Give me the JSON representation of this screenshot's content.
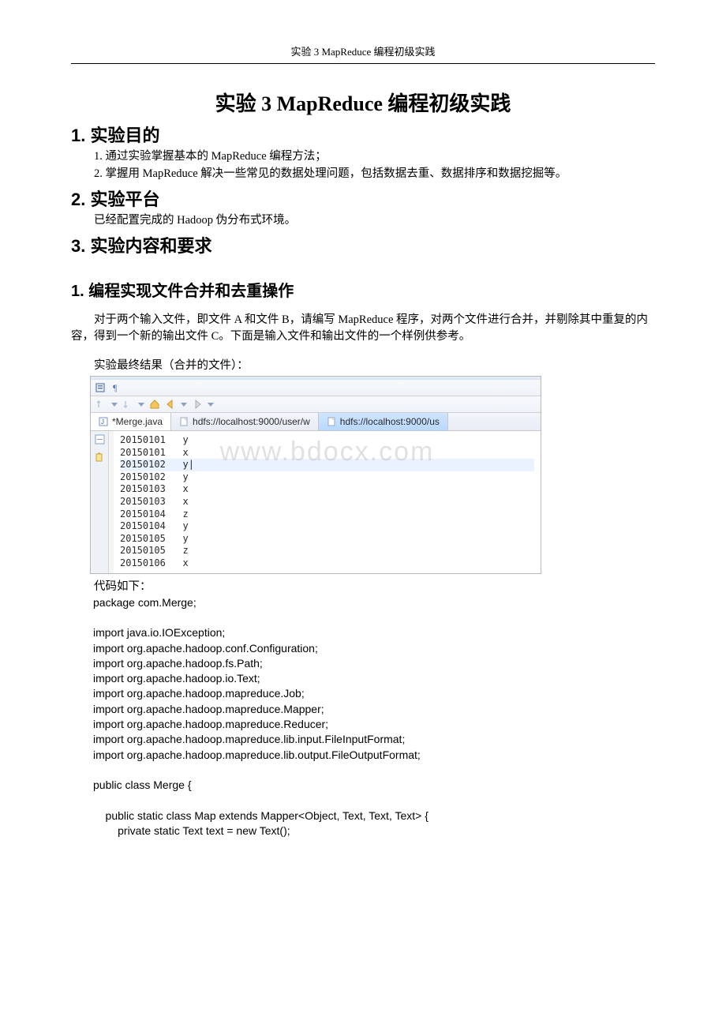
{
  "running_head": "实验 3 MapReduce 编程初级实践",
  "title": "实验 3 MapReduce 编程初级实践",
  "sections": {
    "s1_heading": "1.  实验目的",
    "s1_p1": "1. 通过实验掌握基本的 MapReduce 编程方法；",
    "s1_p2": "2. 掌握用 MapReduce 解决一些常见的数据处理问题，包括数据去重、数据排序和数据挖掘等。",
    "s2_heading": "2.  实验平台",
    "s2_p1": "已经配置完成的 Hadoop 伪分布式环境。",
    "s3_heading": "3.  实验内容和要求",
    "s3_sub1": "1. 编程实现文件合并和去重操作",
    "s3_p1": "对于两个输入文件，即文件 A 和文件 B，请编写 MapReduce 程序，对两个文件进行合并，并剔除其中重复的内容，得到一个新的输出文件 C。下面是输入文件和输出文件的一个样例供参考。",
    "screenshot_caption": "实验最终结果（合并的文件）："
  },
  "editor": {
    "tabs": [
      {
        "label": "*Merge.java",
        "kind": "java",
        "active": false
      },
      {
        "label": "hdfs://localhost:9000/user/w",
        "kind": "file",
        "active": false
      },
      {
        "label": "hdfs://localhost:9000/us",
        "kind": "file",
        "active": true
      }
    ],
    "watermark": "www.bdocx.com",
    "rows": [
      {
        "date": "20150101",
        "val": "y",
        "hl": false
      },
      {
        "date": "20150101",
        "val": "x",
        "hl": false
      },
      {
        "date": "20150102",
        "val": "y",
        "hl": true
      },
      {
        "date": "20150102",
        "val": "y",
        "hl": false
      },
      {
        "date": "20150103",
        "val": "x",
        "hl": false
      },
      {
        "date": "20150103",
        "val": "x",
        "hl": false
      },
      {
        "date": "20150104",
        "val": "z",
        "hl": false
      },
      {
        "date": "20150104",
        "val": "y",
        "hl": false
      },
      {
        "date": "20150105",
        "val": "y",
        "hl": false
      },
      {
        "date": "20150105",
        "val": "z",
        "hl": false
      },
      {
        "date": "20150106",
        "val": "x",
        "hl": false
      }
    ]
  },
  "code_caption": "代码如下：",
  "code_lines": [
    "package com.Merge;",
    "",
    "import java.io.IOException;",
    "import org.apache.hadoop.conf.Configuration;",
    "import org.apache.hadoop.fs.Path;",
    "import org.apache.hadoop.io.Text;",
    "import org.apache.hadoop.mapreduce.Job;",
    "import org.apache.hadoop.mapreduce.Mapper;",
    "import org.apache.hadoop.mapreduce.Reducer;",
    "import org.apache.hadoop.mapreduce.lib.input.FileInputFormat;",
    "import org.apache.hadoop.mapreduce.lib.output.FileOutputFormat;",
    "",
    "public class Merge {",
    "",
    "    public static class Map extends Mapper<Object, Text, Text, Text> {",
    "        private static Text text = new Text();"
  ]
}
